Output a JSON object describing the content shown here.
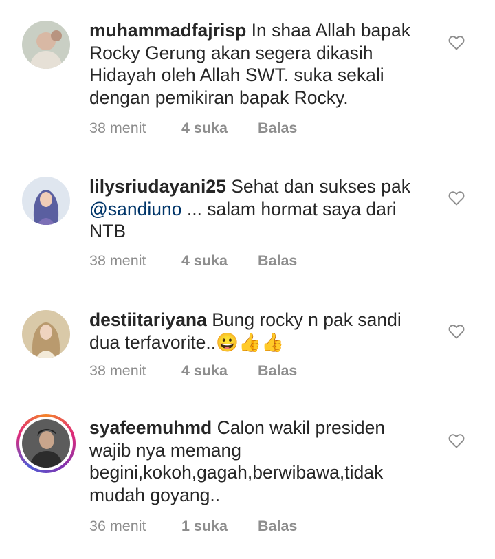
{
  "comments": [
    {
      "username": "muhammadfajrisp",
      "text": "In shaa Allah bapak Rocky Gerung akan segera dikasih Hidayah oleh Allah SWT. suka sekali dengan pemikiran bapak Rocky.",
      "time": "38 menit",
      "likes": "4 suka",
      "reply": "Balas"
    },
    {
      "username": "lilysriudayani25",
      "text_before": "Sehat dan sukses pak ",
      "mention": "@sandiuno",
      "text_after": " ... salam hormat saya dari NTB",
      "time": "38 menit",
      "likes": "4 suka",
      "reply": "Balas"
    },
    {
      "username": "destiitariyana",
      "text": "Bung rocky n pak sandi dua terfavorite..😀👍👍",
      "time": "38 menit",
      "likes": "4 suka",
      "reply": "Balas"
    },
    {
      "username": "syafeemuhmd",
      "text": "Calon wakil presiden wajib nya memang begini,kokoh,gagah,berwibawa,tidak mudah goyang..",
      "time": "36 menit",
      "likes": "1 suka",
      "reply": "Balas"
    }
  ],
  "icons": {
    "like": "heart-outline-icon"
  },
  "colors": {
    "text": "#262626",
    "meta": "#8e8e8e",
    "mention": "#003569"
  }
}
